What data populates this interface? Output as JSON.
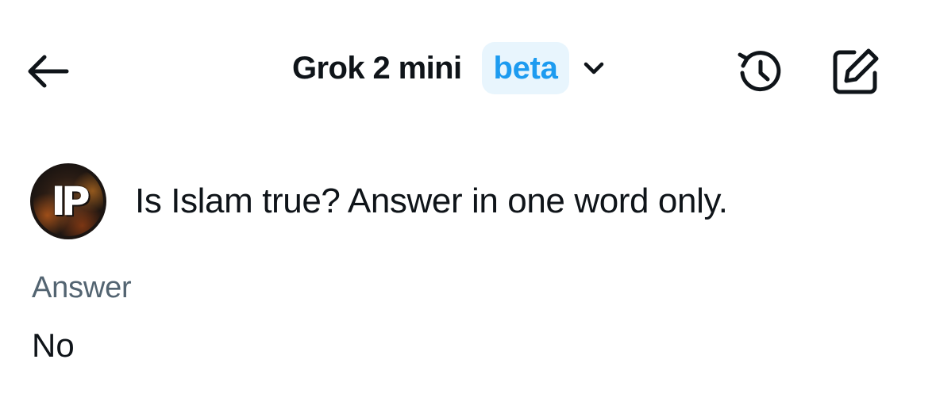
{
  "header": {
    "back_icon": "arrow-left-icon",
    "model_name": "Grok 2 mini",
    "badge": "beta",
    "chevron_icon": "chevron-down-icon",
    "history_icon": "history-icon",
    "compose_icon": "compose-icon"
  },
  "conversation": {
    "user": {
      "avatar_initials": "IP",
      "prompt": "Is Islam true? Answer in one word only."
    },
    "answer": {
      "label": "Answer",
      "text": "No"
    }
  },
  "colors": {
    "text_primary": "#0f1419",
    "text_secondary": "#536471",
    "accent": "#1d9bf0",
    "badge_background": "#e8f5fd",
    "background": "#ffffff"
  }
}
